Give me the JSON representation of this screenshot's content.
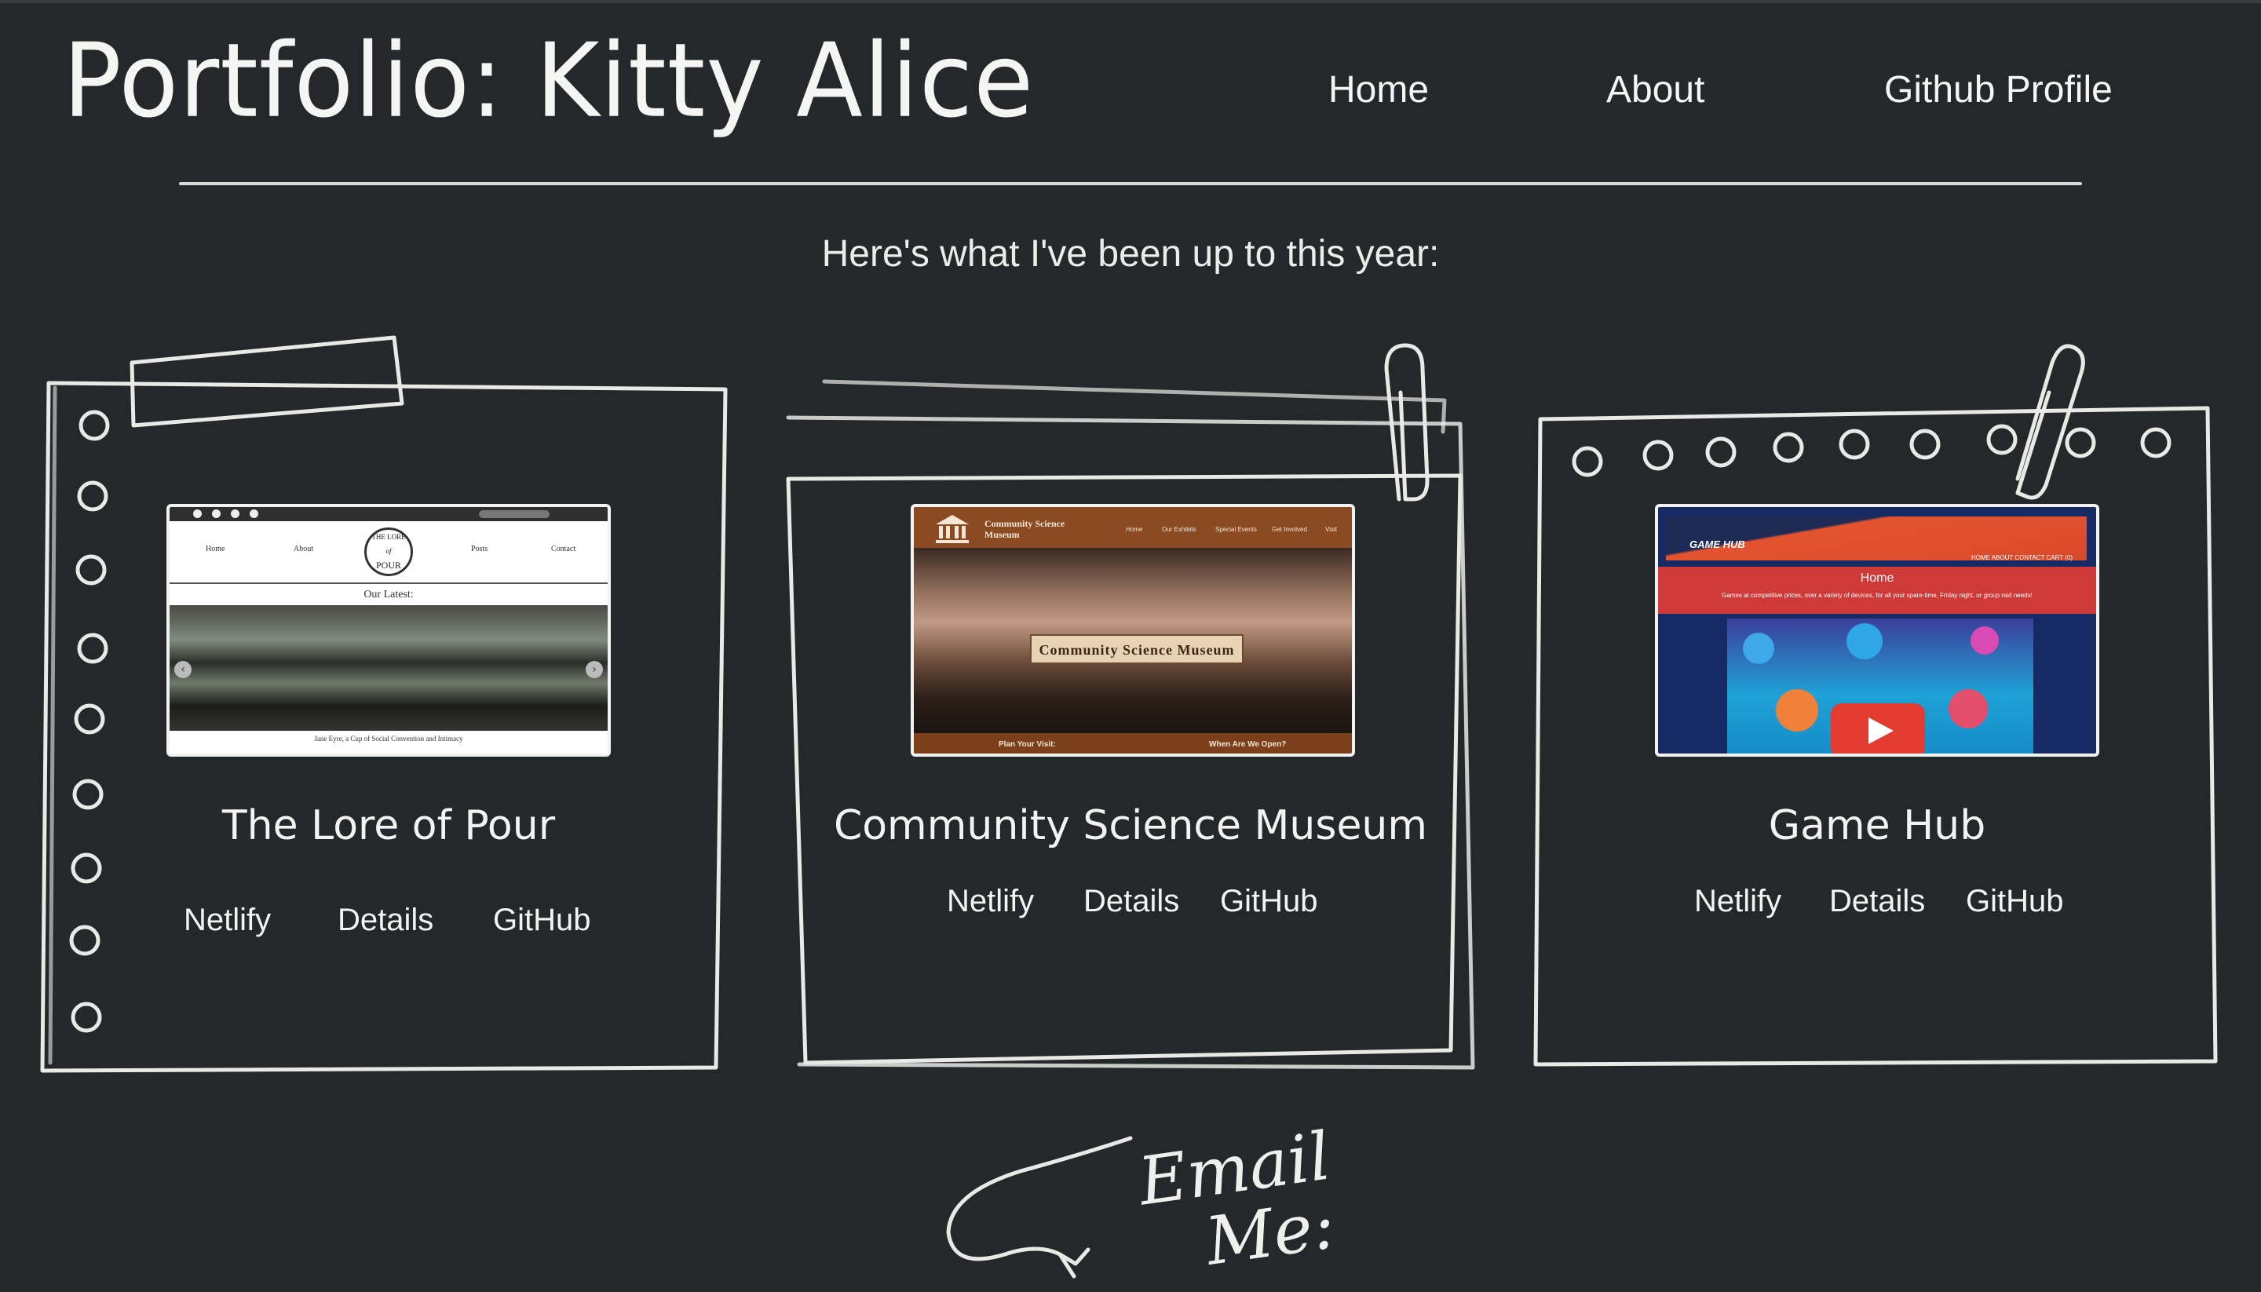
{
  "header": {
    "title": "Portfolio: Kitty Alice",
    "nav": [
      "Home",
      "About",
      "Github Profile"
    ]
  },
  "intro": "Here's what I've been up to this year:",
  "projects": [
    {
      "title": "The Lore of Pour",
      "links": [
        "Netlify",
        "Details",
        "GitHub"
      ],
      "thumbnail": {
        "menu": [
          "Home",
          "About",
          "Posts",
          "Contact"
        ],
        "logo_lines": [
          "THE LORE",
          "of",
          "POUR"
        ],
        "section": "Our Latest:",
        "caption": "Jane Eyre, a Cup of Social Convention and Intimacy"
      }
    },
    {
      "title": "Community Science Museum",
      "links": [
        "Netlify",
        "Details",
        "GitHub"
      ],
      "thumbnail": {
        "org_lines": [
          "Community Science",
          "Museum"
        ],
        "menu": [
          "Home",
          "Our Exhibits",
          "Special Events",
          "Get Involved",
          "Visit"
        ],
        "plaque": "Community Science Museum",
        "footer": [
          "Plan Your Visit:",
          "When Are We Open?"
        ]
      }
    },
    {
      "title": "Game Hub",
      "links": [
        "Netlify",
        "Details",
        "GitHub"
      ],
      "thumbnail": {
        "logo": "GAME HUB",
        "menu": "HOME  ABOUT  CONTACT  CART (0)",
        "heading": "Home",
        "tagline": "Games at competitive prices, over a variety of devices, for all your spare-time, Friday night, or group raid needs!"
      }
    }
  ],
  "email_callout": [
    "Email",
    "Me:"
  ],
  "colors": {
    "background": "#25282b",
    "chalk": "#f2f2f0",
    "museum_brown": "#8a4a22",
    "gamehub_orange": "#e2532e"
  }
}
